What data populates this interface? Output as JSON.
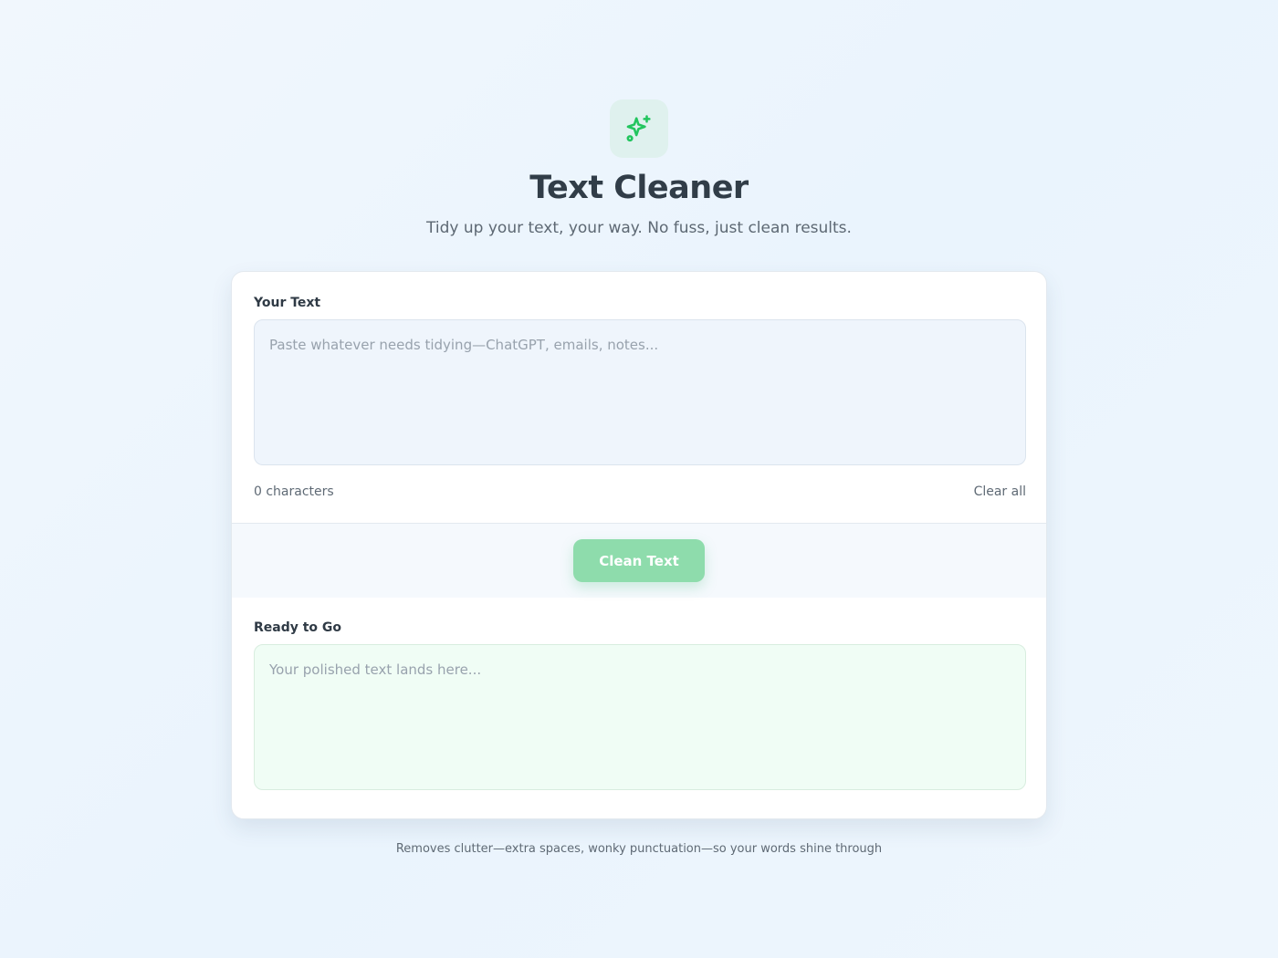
{
  "header": {
    "icon": "sparkles-icon",
    "title": "Text Cleaner",
    "subtitle": "Tidy up your text, your way. No fuss, just clean results."
  },
  "input": {
    "label": "Your Text",
    "value": "",
    "placeholder": "Paste whatever needs tidying—ChatGPT, emails, notes...",
    "char_count": "0 characters",
    "clear_label": "Clear all"
  },
  "action": {
    "clean_label": "Clean Text"
  },
  "output": {
    "label": "Ready to Go",
    "value": "",
    "placeholder": "Your polished text lands here..."
  },
  "footer": {
    "note": "Removes clutter—extra spaces, wonky punctuation—so your words shine through"
  },
  "colors": {
    "accent": "#22c55e",
    "button_bg": "#8edcac",
    "icon_tile_bg": "#dff1ee",
    "input_bg": "#eff5fc",
    "output_bg": "#f0fdf5"
  }
}
